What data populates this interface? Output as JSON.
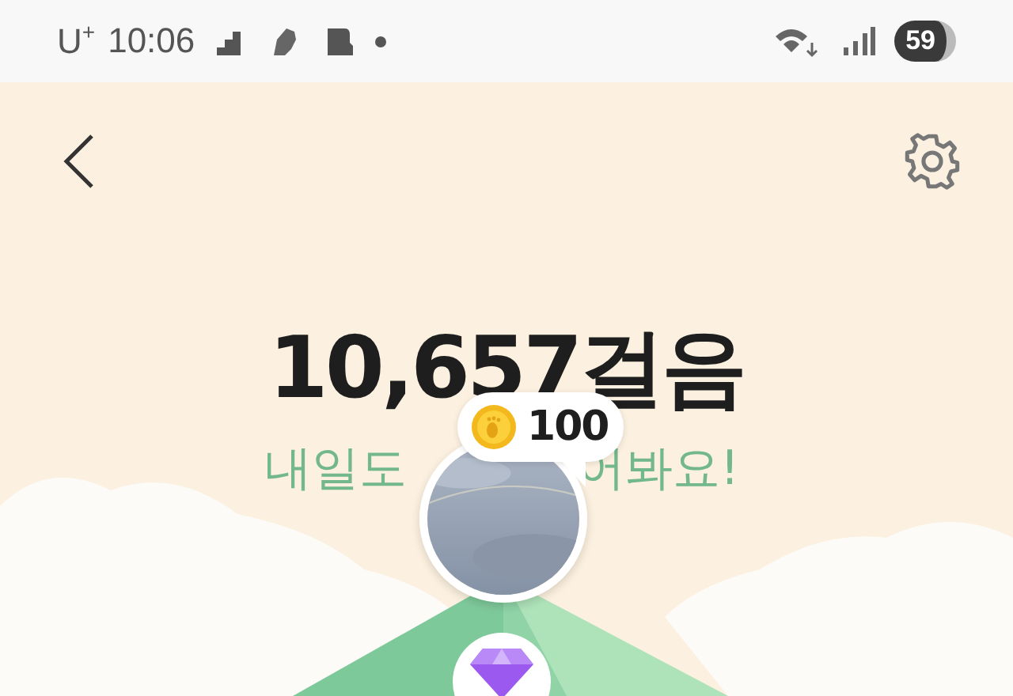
{
  "status_bar": {
    "carrier": "U$^{+}$",
    "time": "10:06",
    "battery": "59"
  },
  "steps": {
    "count": "10,657걸음",
    "message_start": "내일도",
    "message_end": "어봐요!"
  },
  "reward": {
    "amount": "100"
  }
}
